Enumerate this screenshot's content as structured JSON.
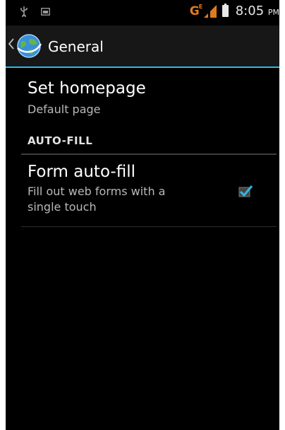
{
  "status_bar": {
    "network_type": "G",
    "network_sup": "E",
    "time": "8:05",
    "ampm": "PM",
    "icons": [
      "usb-icon",
      "image-icon",
      "signal-icon",
      "battery-icon"
    ]
  },
  "action_bar": {
    "title": "General",
    "icon": "browser-globe-icon",
    "accent_color": "#33b5e5"
  },
  "preferences": {
    "homepage": {
      "title": "Set homepage",
      "summary": "Default page"
    },
    "autofill_header": "AUTO-FILL",
    "form_autofill": {
      "title": "Form auto-fill",
      "summary_line1": "Fill out web forms with a",
      "summary_line2": "single touch",
      "checked": true
    }
  }
}
